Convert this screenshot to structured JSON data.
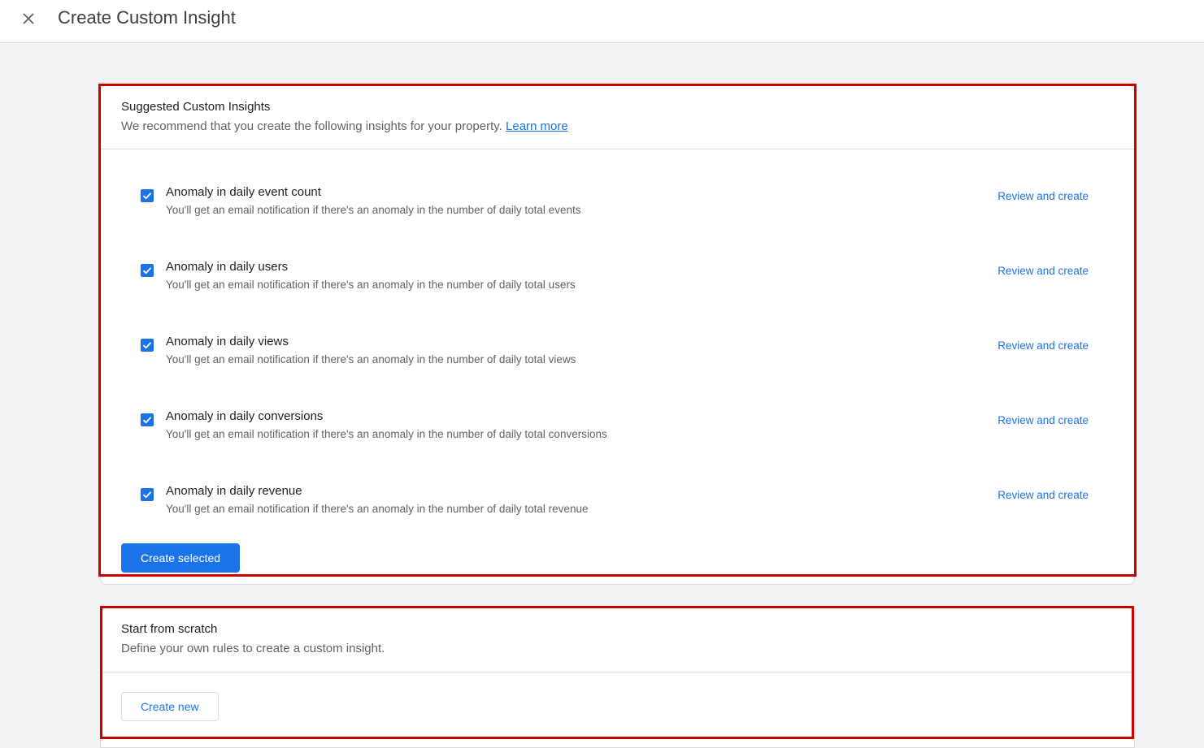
{
  "header": {
    "title": "Create Custom Insight",
    "close_icon": "close-icon"
  },
  "suggested": {
    "title": "Suggested Custom Insights",
    "subtitle": "We recommend that you create the following insights for your property.",
    "learn_more": "Learn more",
    "items": [
      {
        "title": "Anomaly in daily event count",
        "description": "You'll get an email notification if there's an anomaly in the number of daily total events",
        "action": "Review and create",
        "checked": true
      },
      {
        "title": "Anomaly in daily users",
        "description": "You'll get an email notification if there's an anomaly in the number of daily total users",
        "action": "Review and create",
        "checked": true
      },
      {
        "title": "Anomaly in daily views",
        "description": "You'll get an email notification if there's an anomaly in the number of daily total views",
        "action": "Review and create",
        "checked": true
      },
      {
        "title": "Anomaly in daily conversions",
        "description": "You'll get an email notification if there's an anomaly in the number of daily total conversions",
        "action": "Review and create",
        "checked": true
      },
      {
        "title": "Anomaly in daily revenue",
        "description": "You'll get an email notification if there's an anomaly in the number of daily total revenue",
        "action": "Review and create",
        "checked": true
      }
    ],
    "create_selected": "Create selected"
  },
  "scratch": {
    "title": "Start from scratch",
    "subtitle": "Define your own rules to create a custom insight.",
    "create_new": "Create new"
  },
  "colors": {
    "accent": "#1a73e8",
    "highlight": "#cc0000",
    "background": "#f1f3f4"
  }
}
